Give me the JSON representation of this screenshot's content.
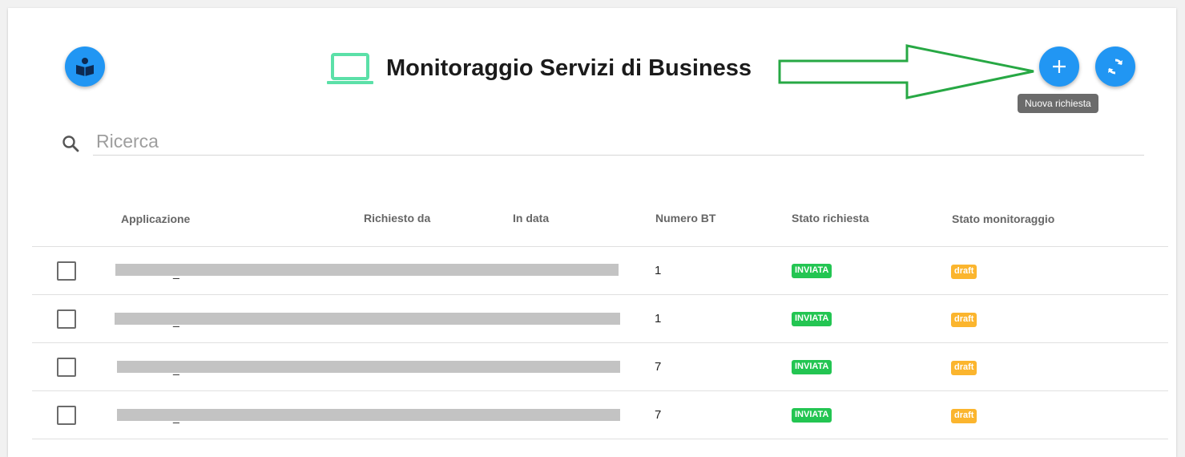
{
  "header": {
    "title": "Monitoraggio Servizi di Business",
    "tooltip": "Nuova richiesta"
  },
  "search": {
    "placeholder": "Ricerca",
    "value": ""
  },
  "table": {
    "columns": [
      "Applicazione",
      "Richiesto da",
      "In data",
      "Numero BT",
      "Stato richiesta",
      "Stato monitoraggio"
    ],
    "rows": [
      {
        "applicazione": "_",
        "numero_bt": "1",
        "stato_richiesta": "INVIATA",
        "stato_monitoraggio": "draft"
      },
      {
        "applicazione": "_",
        "numero_bt": "1",
        "stato_richiesta": "INVIATA",
        "stato_monitoraggio": "draft"
      },
      {
        "applicazione": "_",
        "numero_bt": "7",
        "stato_richiesta": "INVIATA",
        "stato_monitoraggio": "draft"
      },
      {
        "applicazione": "_",
        "numero_bt": "7",
        "stato_richiesta": "INVIATA",
        "stato_monitoraggio": "draft"
      }
    ]
  },
  "colors": {
    "accent": "#2196f3",
    "laptop_icon": "#5be0a8",
    "status_sent": "#23c552",
    "status_draft": "#fbb52e",
    "annotation_arrow": "#27a844"
  },
  "icons": {
    "left_button": "book-reader-icon",
    "title": "laptop-icon",
    "add": "plus-icon",
    "refresh": "refresh-icon",
    "search": "search-icon"
  }
}
